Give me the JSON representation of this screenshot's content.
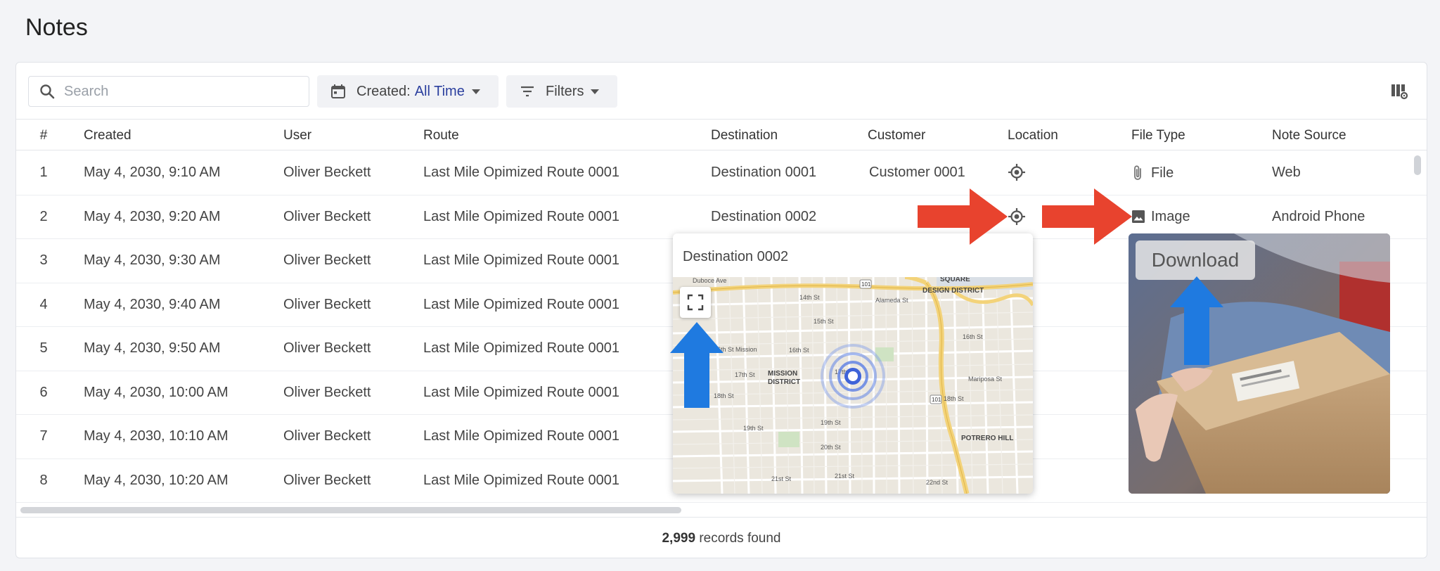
{
  "page": {
    "title": "Notes"
  },
  "toolbar": {
    "search_placeholder": "Search",
    "created_label": "Created:",
    "created_value": "All Time",
    "filters_label": "Filters"
  },
  "table": {
    "columns": [
      "#",
      "Created",
      "User",
      "Route",
      "Destination",
      "Customer",
      "Location",
      "File Type",
      "Note Source"
    ],
    "rows": [
      {
        "num": "1",
        "created": "May 4, 2030, 9:10 AM",
        "user": "Oliver Beckett",
        "route": "Last Mile Opimized Route 0001",
        "destination": "Destination 0001",
        "customer": "Customer 0001",
        "file_type": "File",
        "file_icon": "paperclip-icon",
        "source": "Web"
      },
      {
        "num": "2",
        "created": "May 4, 2030, 9:20 AM",
        "user": "Oliver Beckett",
        "route": "Last Mile Opimized Route 0001",
        "destination": "Destination 0002",
        "customer": "",
        "file_type": "Image",
        "file_icon": "image-icon",
        "source": "Android Phone"
      },
      {
        "num": "3",
        "created": "May 4, 2030, 9:30 AM",
        "user": "Oliver Beckett",
        "route": "Last Mile Opimized Route 0001"
      },
      {
        "num": "4",
        "created": "May 4, 2030, 9:40 AM",
        "user": "Oliver Beckett",
        "route": "Last Mile Opimized Route 0001"
      },
      {
        "num": "5",
        "created": "May 4, 2030, 9:50 AM",
        "user": "Oliver Beckett",
        "route": "Last Mile Opimized Route 0001"
      },
      {
        "num": "6",
        "created": "May 4, 2030, 10:00 AM",
        "user": "Oliver Beckett",
        "route": "Last Mile Opimized Route 0001"
      },
      {
        "num": "7",
        "created": "May 4, 2030, 10:10 AM",
        "user": "Oliver Beckett",
        "route": "Last Mile Opimized Route 0001"
      },
      {
        "num": "8",
        "created": "May 4, 2030, 10:20 AM",
        "user": "Oliver Beckett",
        "route": "Last Mile Opimized Route 0001"
      }
    ]
  },
  "footer": {
    "count": "2,999",
    "suffix": "records found"
  },
  "map_popup": {
    "title": "Destination 0002",
    "labels": {
      "duboce": "Duboce Ave",
      "square": "SQUARE",
      "design": "DESIGN DISTRICT",
      "alameda": "Alameda St",
      "st14": "14th St",
      "st15": "15th St",
      "st16": "16th St",
      "st16_mission": "16th St Mission",
      "st17": "17th St",
      "st18": "18th St",
      "st19": "19th St",
      "st20": "20th St",
      "st21": "21st St",
      "st22": "22nd St",
      "mission1": "MISSION",
      "mission2": "DISTRICT",
      "potrero": "POTRERO HILL",
      "mariposa": "Mariposa St",
      "shield": "101"
    }
  },
  "image_popup": {
    "download_label": "Download"
  },
  "colors": {
    "accent": "#2b3f9e",
    "red_arrow": "#e8432e",
    "blue_arrow": "#1f7ae0"
  }
}
